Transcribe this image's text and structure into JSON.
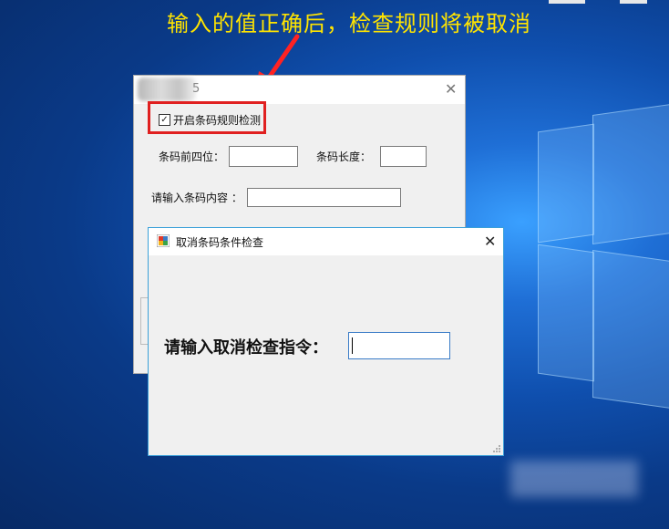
{
  "annotation": {
    "caption": "输入的值正确后，检查规则将被取消"
  },
  "back_window": {
    "title_partial": "5",
    "checkbox": {
      "label": "开启条码规则检测",
      "checked": true
    },
    "fields": {
      "prefix_label": "条码前四位：",
      "length_label": "条码长度：",
      "content_label": "请输入条码内容 ："
    },
    "close_glyph": "✕"
  },
  "dialog": {
    "title": "取消条码条件检查",
    "close_glyph": "✕",
    "prompt_label": "请输入取消检查指令：",
    "input_value": ""
  },
  "colors": {
    "caption": "#ffe400",
    "highlight_box": "#e02020",
    "arrow": "#ff2222",
    "focus_border": "#3a7cc7"
  }
}
